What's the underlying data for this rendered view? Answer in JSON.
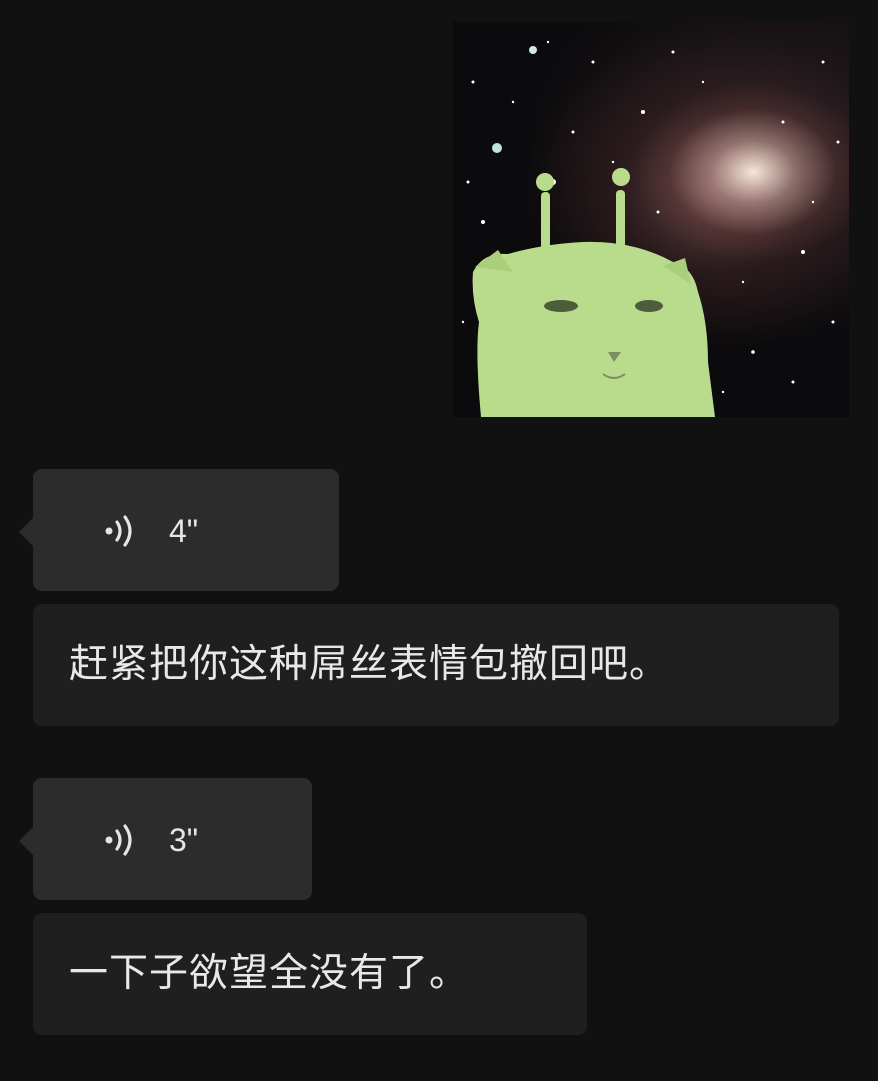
{
  "messages": [
    {
      "type": "sticker",
      "side": "right",
      "alt_icon": "green-alien-cat-in-space-sticker"
    },
    {
      "type": "voice",
      "side": "left",
      "duration": "4\"",
      "transcript": "赶紧把你这种屌丝表情包撤回吧。"
    },
    {
      "type": "voice",
      "side": "left",
      "duration": "3\"",
      "transcript": "一下子欲望全没有了。"
    }
  ],
  "colors": {
    "background": "#111111",
    "voice_bubble": "#2c2c2c",
    "transcript_bubble": "#1f1f1f",
    "text": "#e6e6e6",
    "sticker_cat": "#b9dc8c"
  }
}
